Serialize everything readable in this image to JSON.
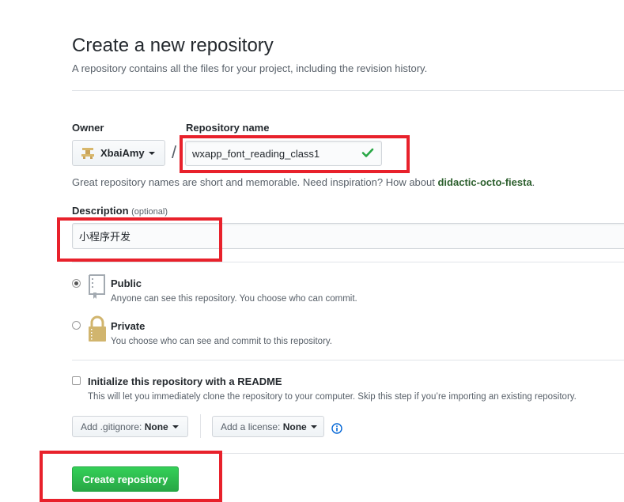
{
  "page": {
    "title": "Create a new repository",
    "subtitle": "A repository contains all the files for your project, including the revision history."
  },
  "owner": {
    "label": "Owner",
    "value": "XbaiAmy",
    "separator": "/"
  },
  "repo_name": {
    "label": "Repository name",
    "value": "wxapp_font_reading_class1",
    "status": "valid",
    "status_color": "#28a745"
  },
  "hint": {
    "text": "Great repository names are short and memorable. Need inspiration? How about",
    "suggestion": "didactic-octo-fiesta",
    "end": "."
  },
  "description": {
    "label": "Description",
    "optional": "(optional)",
    "value": "小程序开发"
  },
  "visibility": {
    "public": {
      "label": "Public",
      "desc": "Anyone can see this repository. You choose who can commit.",
      "selected": true,
      "icon": "repo-icon"
    },
    "private": {
      "label": "Private",
      "desc": "You choose who can see and commit to this repository.",
      "selected": false,
      "icon": "lock-icon"
    }
  },
  "readme": {
    "label": "Initialize this repository with a README",
    "desc": "This will let you immediately clone the repository to your computer. Skip this step if you’re importing an existing repository.",
    "checked": false
  },
  "gitignore": {
    "prefix": "Add .gitignore:",
    "value": "None"
  },
  "license": {
    "prefix": "Add a license:",
    "value": "None"
  },
  "submit": {
    "label": "Create repository",
    "color": "#28a745"
  },
  "annotation_color": "#e8212b"
}
